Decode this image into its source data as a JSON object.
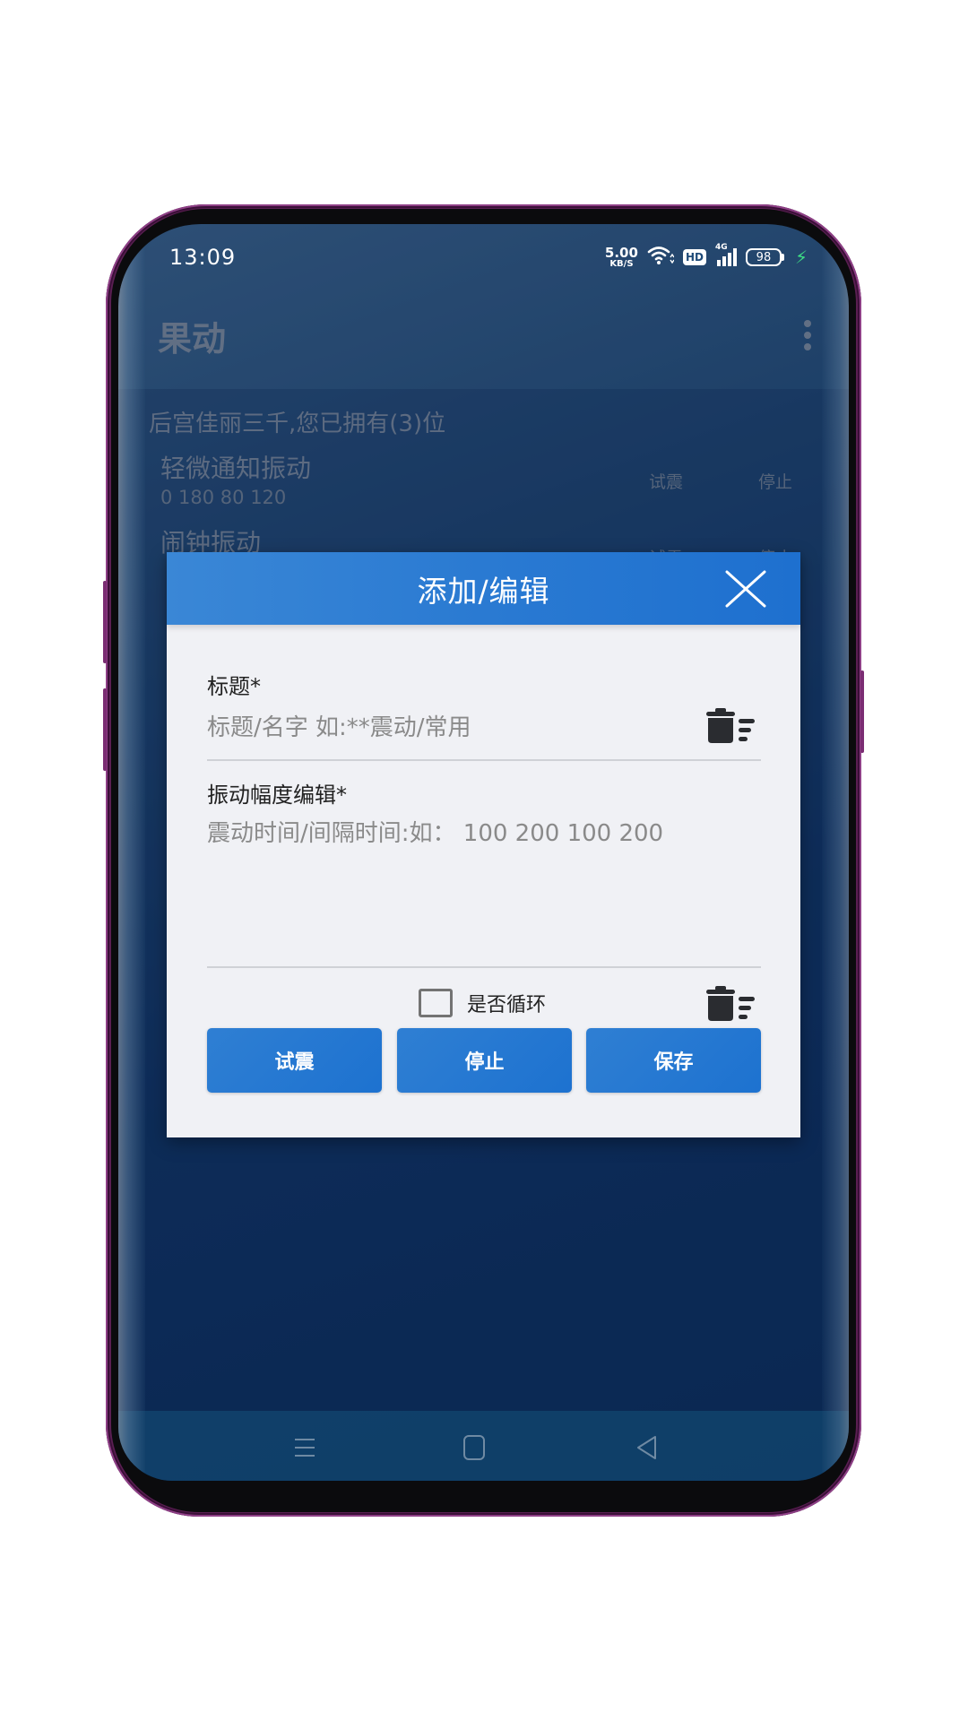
{
  "status_bar": {
    "time": "13:09",
    "net_speed_value": "5.00",
    "net_speed_unit": "KB/S",
    "hd_badge": "HD",
    "network_type": "4G",
    "battery_level": "98",
    "charging_color": "#3ddc84"
  },
  "app": {
    "title": "果动",
    "menu_icon": "overflow-menu-icon",
    "count_text": "后宫佳丽三千,您已拥有(3)位",
    "items": [
      {
        "title": "轻微通知振动",
        "pattern": "0 180 80 120",
        "test_label": "试震",
        "stop_label": "停止"
      },
      {
        "title": "闹钟振动",
        "pattern": "",
        "test_label": "试震",
        "stop_label": "停止"
      }
    ]
  },
  "dialog": {
    "title": "添加/编辑",
    "close_icon": "close-icon",
    "title_field": {
      "label": "标题*",
      "value": "",
      "placeholder": "标题/名字 如:**震动/常用"
    },
    "pattern_field": {
      "label": "振动幅度编辑*",
      "value": "",
      "placeholder": "震动时间/间隔时间:如： 100 200 100 200"
    },
    "loop_checkbox": {
      "label": "是否循环",
      "checked": false
    },
    "buttons": {
      "test": "试震",
      "stop": "停止",
      "save": "保存"
    },
    "accent_color": "#2a7ad2"
  },
  "nav_bar": {
    "menu_icon": "recent-apps-icon",
    "home_icon": "home-icon",
    "back_icon": "back-icon"
  }
}
